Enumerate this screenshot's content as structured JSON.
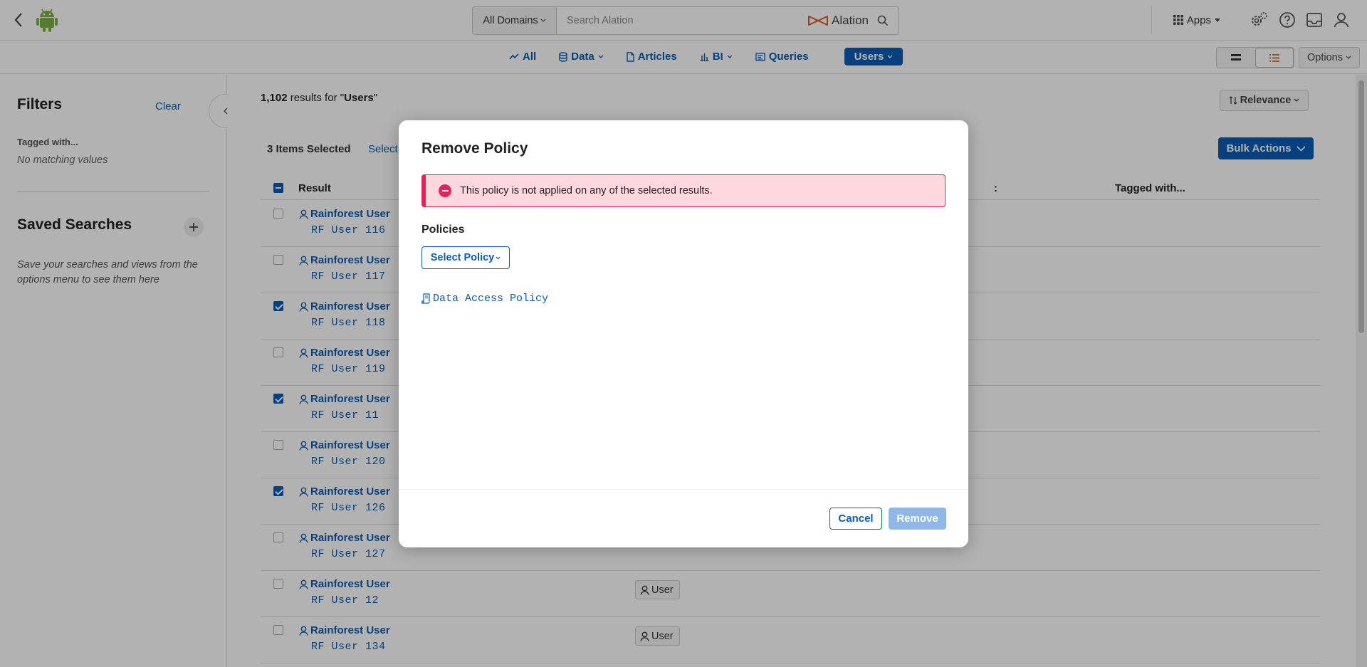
{
  "topbar": {
    "domains_label": "All Domains",
    "search_placeholder": "Search Alation",
    "brand_name": "Alation",
    "apps_label": "Apps"
  },
  "nav_tabs": [
    {
      "label": "All",
      "icon": "trend-icon",
      "active": false
    },
    {
      "label": "Data",
      "icon": "database-icon",
      "active": false,
      "dropdown": true
    },
    {
      "label": "Articles",
      "icon": "document-icon",
      "active": false
    },
    {
      "label": "BI",
      "icon": "bar-chart-icon",
      "active": false,
      "dropdown": true
    },
    {
      "label": "Queries",
      "icon": "query-icon",
      "active": false
    },
    {
      "label": "Users",
      "icon": "",
      "active": true,
      "dropdown": true
    }
  ],
  "options_label": "Options",
  "filters": {
    "title": "Filters",
    "clear_label": "Clear",
    "tagged_label": "Tagged with...",
    "no_matching": "No matching values"
  },
  "saved_searches": {
    "title": "Saved Searches",
    "description": "Save your searches and views from the options menu to see them here"
  },
  "results": {
    "count": "1,102",
    "middle": " results for \"",
    "query": "Users",
    "end": "\"",
    "sort_label": "Relevance",
    "selected_label": "3 Items Selected",
    "select_link": "Select",
    "bulk_label": "Bulk Actions",
    "col_result": "Result",
    "col_partial": ":",
    "col_tagged": "Tagged with...",
    "rows": [
      {
        "name": "Rainforest User",
        "username": "RF User 116",
        "checked": false,
        "tag": ""
      },
      {
        "name": "Rainforest User",
        "username": "RF User 117",
        "checked": false,
        "tag": ""
      },
      {
        "name": "Rainforest User",
        "username": "RF User 118",
        "checked": true,
        "tag": ""
      },
      {
        "name": "Rainforest User",
        "username": "RF User 119",
        "checked": false,
        "tag": ""
      },
      {
        "name": "Rainforest User",
        "username": "RF User 11",
        "checked": true,
        "tag": ""
      },
      {
        "name": "Rainforest User",
        "username": "RF User 120",
        "checked": false,
        "tag": ""
      },
      {
        "name": "Rainforest User",
        "username": "RF User 126",
        "checked": true,
        "tag": ""
      },
      {
        "name": "Rainforest User",
        "username": "RF User 127",
        "checked": false,
        "tag": ""
      },
      {
        "name": "Rainforest User",
        "username": "RF User 12",
        "checked": false,
        "tag": "User"
      },
      {
        "name": "Rainforest User",
        "username": "RF User 134",
        "checked": false,
        "tag": "User"
      }
    ]
  },
  "modal": {
    "title": "Remove Policy",
    "alert_text": "This policy is not applied on any of the selected results.",
    "policies_label": "Policies",
    "select_policy_label": "Select Policy",
    "policy_link": "Data Access Policy",
    "cancel_label": "Cancel",
    "remove_label": "Remove"
  },
  "colors": {
    "accent": "#0b5cb5",
    "alert_border": "#e0245e",
    "alert_bg": "#ffd7df",
    "disabled_button": "#8fb8e8"
  }
}
